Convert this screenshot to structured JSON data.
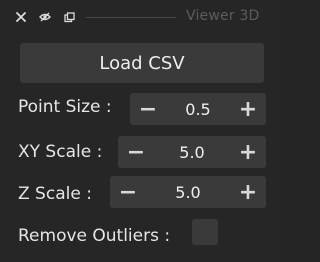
{
  "titlebar": {
    "title": "Viewer 3D",
    "icons": [
      "close-icon",
      "eye-icon",
      "dock-icon"
    ]
  },
  "load_button": {
    "label": "Load CSV"
  },
  "point_size": {
    "label": "Point Size :",
    "value": "0.5",
    "minus": "−",
    "plus": "+"
  },
  "xy_scale": {
    "label": "XY Scale :",
    "value": "5.0",
    "minus": "−",
    "plus": "+"
  },
  "z_scale": {
    "label": "Z Scale :",
    "value": "5.0",
    "minus": "−",
    "plus": "+"
  },
  "remove_outliers": {
    "label": "Remove Outliers :",
    "checked": false
  },
  "colors": {
    "background": "#262627",
    "control": "#3a3a3b",
    "title_dim": "#5c5c5c",
    "text": "#e6e6e6"
  }
}
